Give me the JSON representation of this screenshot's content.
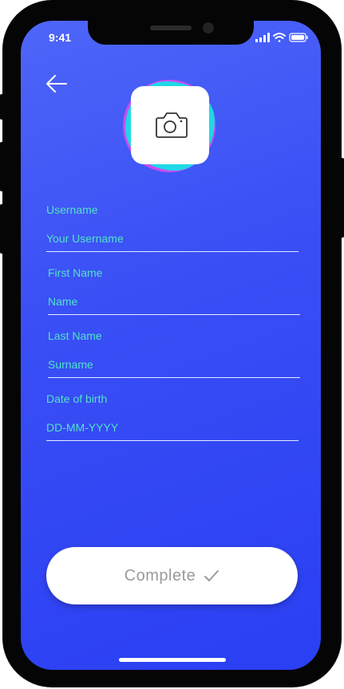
{
  "status_bar": {
    "time": "9:41",
    "icons": [
      "signal-icon",
      "wifi-icon",
      "battery-icon"
    ]
  },
  "header": {
    "back_icon": "back-arrow-icon"
  },
  "avatar": {
    "icon": "camera-icon"
  },
  "form": {
    "username": {
      "label": "Username",
      "placeholder": "Your Username",
      "value": ""
    },
    "first_name": {
      "label": "First Name",
      "placeholder": "Name",
      "value": ""
    },
    "last_name": {
      "label": "Last Name",
      "placeholder": "Surname",
      "value": ""
    },
    "date_of_birth": {
      "label": "Date of birth",
      "placeholder": "DD-MM-YYYY",
      "value": ""
    }
  },
  "complete_button": {
    "label": "Complete",
    "icon": "checkmark-icon"
  },
  "colors": {
    "background_top": "#4e66f8",
    "background_bottom": "#2a3ff3",
    "accent_text": "#52e3c8",
    "blob_cyan": "#1fd8e8",
    "blob_magenta": "#c94bf0",
    "button_text": "#9a9a9a"
  }
}
